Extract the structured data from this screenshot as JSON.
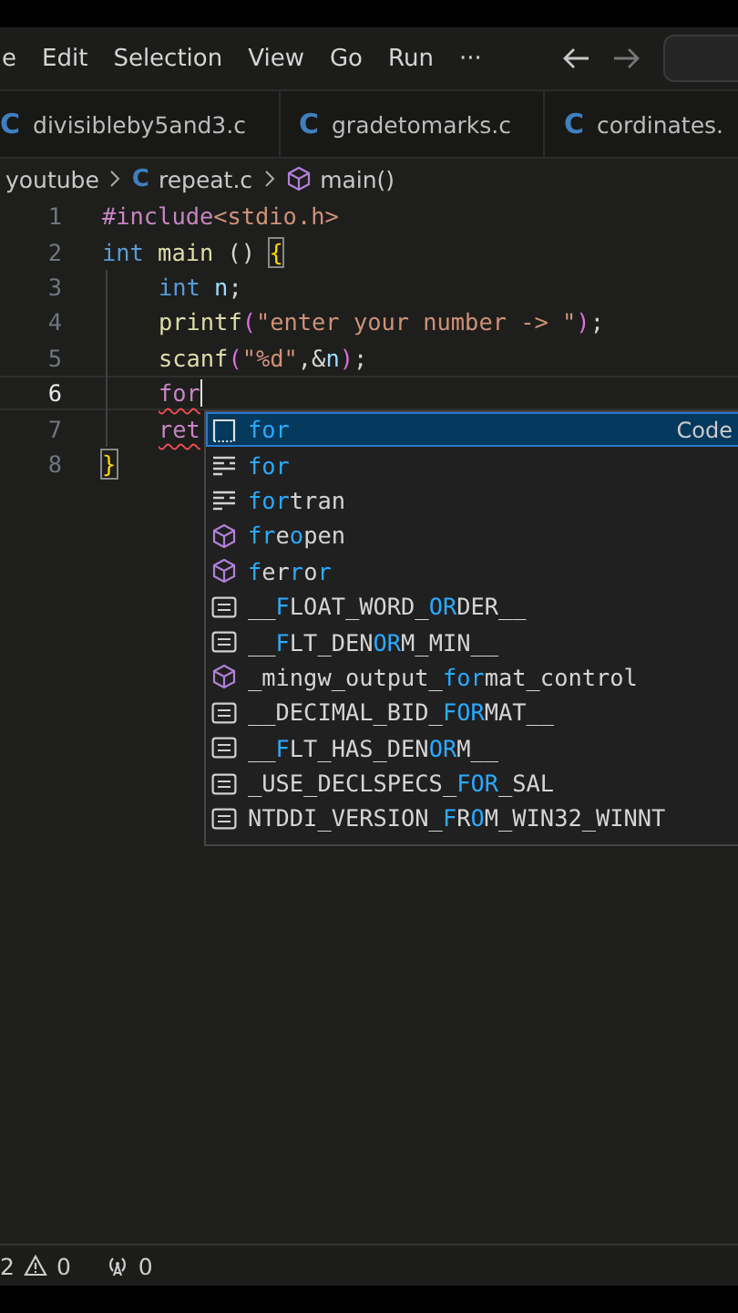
{
  "menu_bar": {
    "items": [
      "e",
      "Edit",
      "Selection",
      "View",
      "Go",
      "Run",
      "···"
    ]
  },
  "tabs": [
    {
      "icon": "C",
      "label": "divisibleby5and3.c",
      "selected": false
    },
    {
      "icon": "C",
      "label": "gradetomarks.c",
      "selected": false
    },
    {
      "icon": "C",
      "label": "cordinates.",
      "selected": false
    }
  ],
  "breadcrumb": {
    "folder": "youtube",
    "file_icon": "C",
    "file": "repeat.c",
    "symbol": "main()"
  },
  "editor": {
    "lines": [
      {
        "number": "1",
        "active": false,
        "tokens": [
          {
            "text": "#include",
            "kind": "preproc"
          },
          {
            "text": "<stdio.h>",
            "kind": "string"
          }
        ]
      },
      {
        "number": "2",
        "active": false,
        "tokens": [
          {
            "text": "int",
            "kind": "keyword"
          },
          {
            "text": " main",
            "kind": "function"
          },
          {
            "text": " () ",
            "kind": "plain"
          },
          {
            "text": "{",
            "kind": "bracket-match"
          }
        ],
        "children": [
          {
            "number": "3",
            "active": false,
            "tokens": [
              {
                "text": "int",
                "kind": "keyword"
              },
              {
                "text": " n",
                "kind": "variable"
              },
              {
                "text": ";",
                "kind": "plain"
              }
            ]
          },
          {
            "number": "4",
            "active": false,
            "tokens": [
              {
                "text": "printf",
                "kind": "function"
              },
              {
                "text": "(",
                "kind": "bracket"
              },
              {
                "text": "\"enter your number -> \"",
                "kind": "string"
              },
              {
                "text": ")",
                "kind": "bracket"
              },
              {
                "text": ";",
                "kind": "plain"
              }
            ]
          },
          {
            "number": "5",
            "active": false,
            "tokens": [
              {
                "text": "scanf",
                "kind": "function"
              },
              {
                "text": "(",
                "kind": "bracket"
              },
              {
                "text": "\"%d\"",
                "kind": "string"
              },
              {
                "text": ",&",
                "kind": "plain"
              },
              {
                "text": "n",
                "kind": "variable"
              },
              {
                "text": ")",
                "kind": "bracket"
              },
              {
                "text": ";",
                "kind": "plain"
              }
            ]
          },
          {
            "number": "6",
            "active": true,
            "tokens": [
              {
                "text": "for",
                "kind": "control-error"
              }
            ]
          },
          {
            "number": "7",
            "active": false,
            "tokens": [
              {
                "text": "ret",
                "kind": "control-error"
              }
            ]
          }
        ]
      },
      {
        "number": "8",
        "active": false,
        "tokens": [
          {
            "text": "}",
            "kind": "bracket-match"
          }
        ]
      }
    ]
  },
  "suggestions": [
    {
      "kind": "snippet",
      "label": "**for**",
      "detail": "Code",
      "selected": true
    },
    {
      "kind": "keyword",
      "label": "**for**",
      "selected": false
    },
    {
      "kind": "keyword",
      "label": "**for**tran",
      "selected": false
    },
    {
      "kind": "method",
      "label": "**fr**e**o**pen",
      "selected": false
    },
    {
      "kind": "method",
      "label": "**f**er**r**o**r**",
      "selected": false
    },
    {
      "kind": "constant",
      "label": "__**F**LOAT_WORD_**OR**DER__",
      "selected": false
    },
    {
      "kind": "constant",
      "label": "__**F**LT_DEN**OR**M_MIN__",
      "selected": false
    },
    {
      "kind": "method",
      "label": "_mingw_output_**for**mat_control",
      "selected": false
    },
    {
      "kind": "constant",
      "label": "__DECIMAL_BID_**FOR**MAT__",
      "selected": false
    },
    {
      "kind": "constant",
      "label": "__**F**LT_HAS_DEN**OR**M__",
      "selected": false
    },
    {
      "kind": "constant",
      "label": "_USE_DECLSPECS_**FOR**_SAL",
      "selected": false
    },
    {
      "kind": "constant",
      "label": "NTDDI_VERSION_**F**R**O**M_WIN32_WINNT",
      "selected": false
    }
  ],
  "status_bar": {
    "errors": "2",
    "warnings": "0",
    "ports": "0"
  }
}
